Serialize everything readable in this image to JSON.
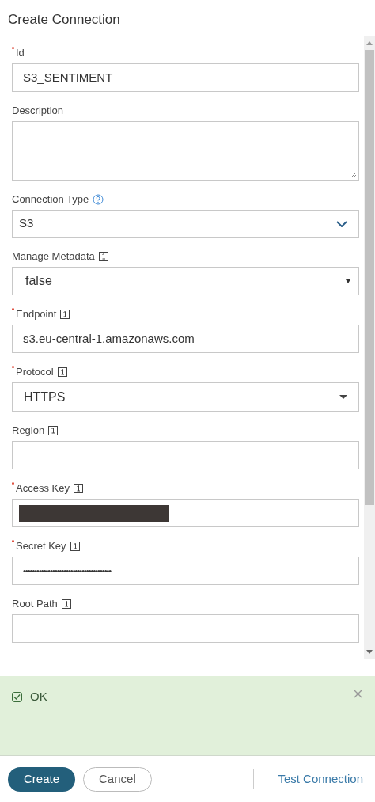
{
  "dialog": {
    "title": "Create Connection"
  },
  "fields": [
    {
      "kind": "text",
      "label": "Id",
      "required": true,
      "value": "S3_SENTIMENT"
    },
    {
      "kind": "textarea",
      "label": "Description",
      "required": false
    },
    {
      "kind": "combo",
      "label": "Connection Type",
      "required": false,
      "help": true,
      "value": "S3"
    },
    {
      "kind": "native-select",
      "label": "Manage Metadata",
      "required": false,
      "info": true,
      "value": "false"
    },
    {
      "kind": "text",
      "label": "Endpoint",
      "required": true,
      "info": true,
      "value": "s3.eu-central-1.amazonaws.com"
    },
    {
      "kind": "select",
      "label": "Protocol",
      "required": true,
      "info": true,
      "value": "HTTPS"
    },
    {
      "kind": "text",
      "label": "Region",
      "required": false,
      "info": true
    },
    {
      "kind": "redacted",
      "label": "Access Key",
      "required": true,
      "info": true
    },
    {
      "kind": "password",
      "label": "Secret Key",
      "required": true,
      "info": true,
      "value": "•••••••••••••••••••••••••••••••••••••••"
    },
    {
      "kind": "text",
      "label": "Root Path",
      "required": false,
      "info": true
    }
  ],
  "message": {
    "kind": "success",
    "text": "OK",
    "dismissible": true
  },
  "footer": {
    "buttons": [
      {
        "kind": "primary",
        "label": "Create"
      },
      {
        "kind": "secondary",
        "label": "Cancel"
      },
      {
        "kind": "link",
        "label": "Test Connection"
      }
    ]
  }
}
